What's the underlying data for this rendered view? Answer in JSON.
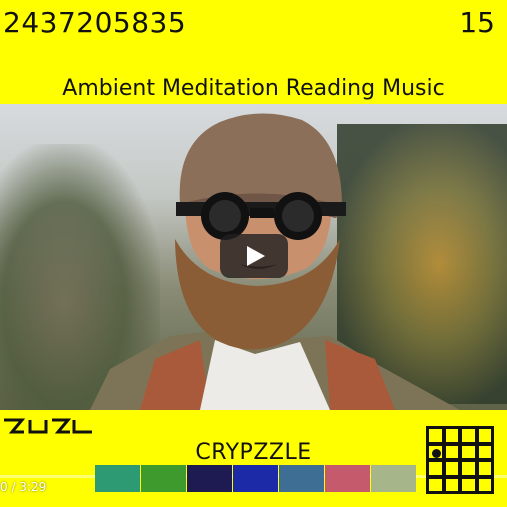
{
  "header": {
    "code": "2437205835",
    "counter": "15",
    "title": "Ambient Meditation Reading Music"
  },
  "video": {
    "play_icon": "play-icon",
    "time": "0 / 3:29"
  },
  "footer": {
    "brand": "CRYPZZLE",
    "logo_icon": "glyph-logo-icon",
    "grid_icon": "grid-icon",
    "swatches": [
      {
        "color": "#2e9a74"
      },
      {
        "color": "#3f9a2e"
      },
      {
        "color": "#1e1a52"
      },
      {
        "color": "#1c2aa8"
      },
      {
        "color": "#3f6e95"
      },
      {
        "color": "#c45a6b"
      },
      {
        "color": "#a7b58a"
      }
    ],
    "accent": "#ffff00"
  }
}
